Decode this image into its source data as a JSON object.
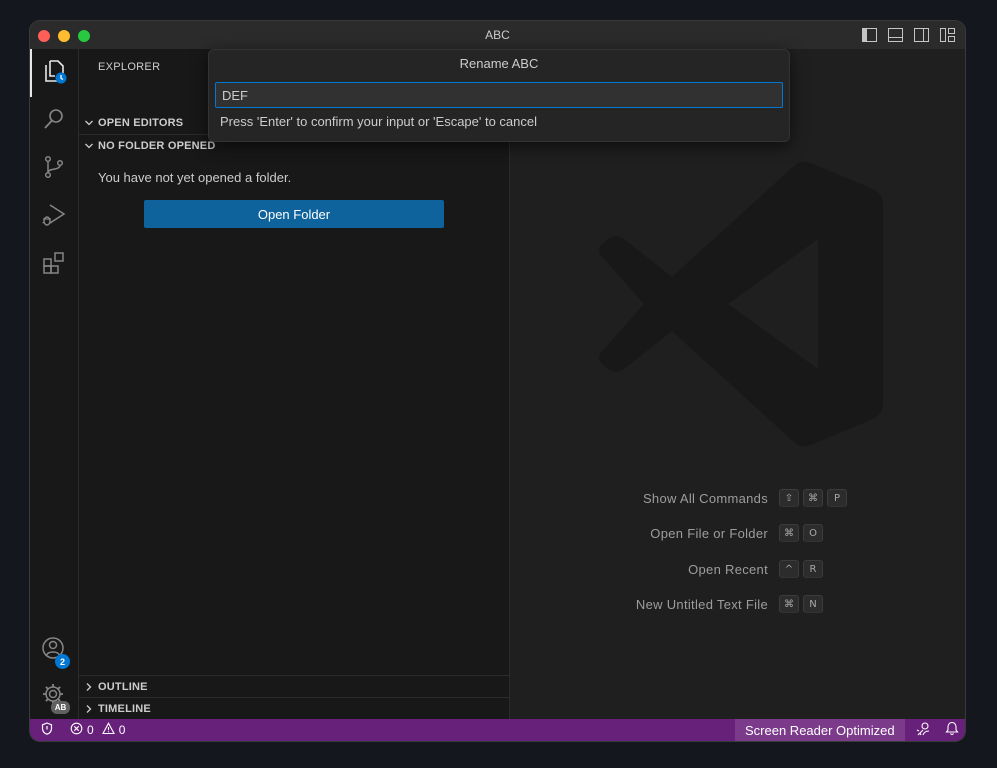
{
  "window": {
    "title": "ABC"
  },
  "activity_bar": {
    "accounts_badge": "2",
    "manage_badge": "AB"
  },
  "sidebar": {
    "title": "EXPLORER",
    "sections": {
      "open_editors": "OPEN EDITORS",
      "no_folder": "NO FOLDER OPENED",
      "outline": "OUTLINE",
      "timeline": "TIMELINE"
    },
    "no_folder_message": "You have not yet opened a folder.",
    "open_folder_button": "Open Folder"
  },
  "quick_input": {
    "title": "Rename ABC",
    "value": "DEF",
    "message": "Press 'Enter' to confirm your input or 'Escape' to cancel"
  },
  "editor": {
    "shortcuts": [
      {
        "label": "Show All Commands",
        "keys": [
          "⇧",
          "⌘",
          "P"
        ]
      },
      {
        "label": "Open File or Folder",
        "keys": [
          "⌘",
          "O"
        ]
      },
      {
        "label": "Open Recent",
        "keys": [
          "^",
          "R"
        ]
      },
      {
        "label": "New Untitled Text File",
        "keys": [
          "⌘",
          "N"
        ]
      }
    ]
  },
  "status_bar": {
    "errors": "0",
    "warnings": "0",
    "screen_reader": "Screen Reader Optimized"
  },
  "colors": {
    "status_bar": "#68217a",
    "accent": "#0078d4",
    "button": "#0e639c"
  }
}
